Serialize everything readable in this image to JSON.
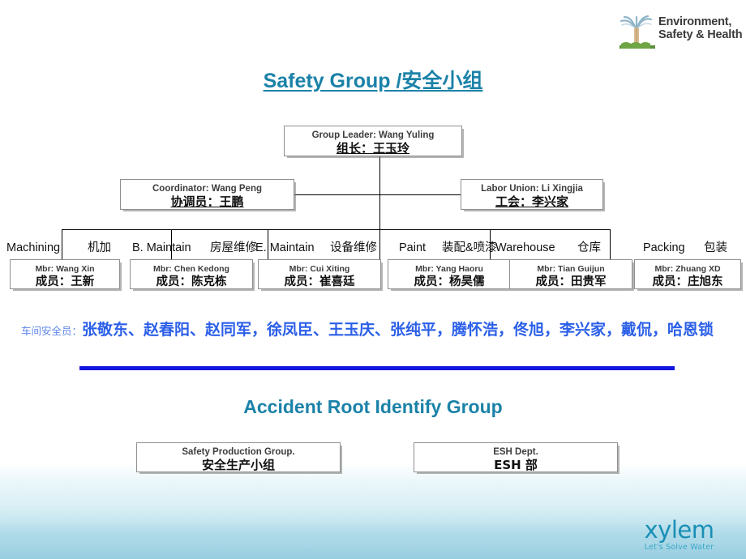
{
  "header": {
    "esh_logo": {
      "line1": "Environment,",
      "line2": "Safety & Health",
      "icon": "tree-logo-icon"
    }
  },
  "titles": {
    "main": "Safety Group /安全小组",
    "sub": "Accident Root Identify Group"
  },
  "org": {
    "leader": {
      "en": "Group Leader: Wang Yuling",
      "cn": "组长：王玉玲"
    },
    "coordinator": {
      "en": "Coordinator: Wang Peng",
      "cn": "协调员：王鹏"
    },
    "labor_union": {
      "en": "Labor Union: Li Xingjia",
      "cn": "工会：李兴家"
    },
    "departments": [
      {
        "en": "Machining",
        "cn": "机加",
        "member_en": "Mbr: Wang Xin",
        "member_cn": "成员：王新"
      },
      {
        "en": "B. Maintain",
        "cn": "房屋维修",
        "member_en": "Mbr: Chen Kedong",
        "member_cn": "成员：陈克栋"
      },
      {
        "en": "E. Maintain",
        "cn": "设备维修",
        "member_en": "Mbr: Cui Xiting",
        "member_cn": "成员：崔喜廷"
      },
      {
        "en": "Paint",
        "cn": "装配&喷漆",
        "member_en": "Mbr: Yang Haoru",
        "member_cn": "成员：杨昊儒"
      },
      {
        "en": "Warehouse",
        "cn": "仓库",
        "member_en": "Mbr: Tian Guijun",
        "member_cn": "成员：田贵军"
      },
      {
        "en": "Packing",
        "cn": "包装",
        "member_en": "Mbr: Zhuang XD",
        "member_cn": "成员：庄旭东"
      }
    ]
  },
  "safety_officers": {
    "lead": "车间安全员：",
    "names": "张敬东、赵春阳、赵同军，徐凤臣、王玉庆、张纯平，腾怀浩，佟旭，李兴家，戴侃，哈恩锁"
  },
  "accident_group": {
    "box1": {
      "en": "Safety Production Group.",
      "cn": "安全生产小组"
    },
    "box2": {
      "en": "ESH Dept.",
      "cn": "ESH 部"
    }
  },
  "footer": {
    "brand": "xylem",
    "tagline": "Let's Solve Water"
  },
  "colors": {
    "title_teal": "#1b82a8",
    "names_blue": "#2b5fe8",
    "rule_blue": "#1414e0",
    "brand_teal": "#1a8fb5",
    "band_blue": "#a0d3e3"
  }
}
